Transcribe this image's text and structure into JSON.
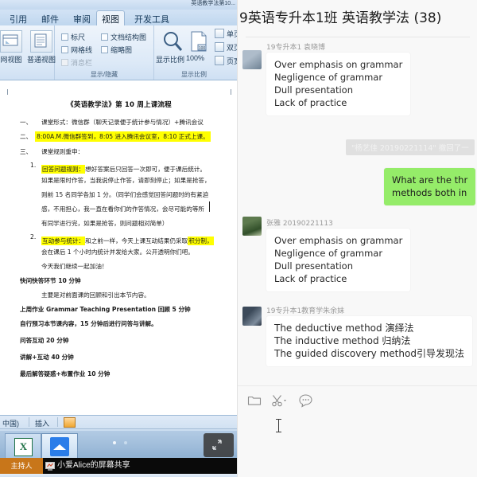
{
  "word": {
    "document_title": "英语教学法第10...",
    "ribbon_tabs": [
      {
        "label": "引用",
        "active": false
      },
      {
        "label": "邮件",
        "active": false
      },
      {
        "label": "审阅",
        "active": false
      },
      {
        "label": "视图",
        "active": true
      },
      {
        "label": "开发工具",
        "active": false
      }
    ],
    "view_buttons": [
      {
        "label": "网视图"
      },
      {
        "label": "普通视图"
      }
    ],
    "show_hide": {
      "group_label": "显示/隐藏",
      "checkboxes": [
        {
          "label": "标尺",
          "checked": false,
          "dim": false
        },
        {
          "label": "文档结构图",
          "checked": false,
          "dim": false
        },
        {
          "label": "网格线",
          "checked": false,
          "dim": false
        },
        {
          "label": "缩略图",
          "checked": false,
          "dim": false
        },
        {
          "label": "消息栏",
          "checked": false,
          "dim": true
        }
      ]
    },
    "zoom_group": {
      "group_label": "显示比例",
      "zoom_button_label": "显示比例",
      "zoom_value": "100%",
      "page_buttons": [
        {
          "label": "单页"
        },
        {
          "label": "双页"
        },
        {
          "label": "页宽"
        }
      ]
    },
    "document": {
      "title": "《英语教学法》第 10 周上课流程",
      "lines": [
        {
          "num": "一、",
          "text": "课堂形式：微信群（聊天记录便于统计参与情况）+腾讯会议",
          "highlight": "none"
        },
        {
          "num": "二、",
          "text": "8:00A.M.微信群签到，8:05 进入腾讯会议室，8:10 正式上课。",
          "highlight": "full"
        },
        {
          "num": "三、",
          "text": "课堂规则重申：",
          "highlight": "none"
        },
        {
          "num": "1.",
          "text": "回答问题规则：想好答案后只回答一次即可，便于课后统计。",
          "highlight": "partial",
          "hl_text": "回答问题规则："
        },
        {
          "num": "",
          "text": "如果是限时作答，当我说停止作答，请即刻停止；如果是抢答，",
          "highlight": "none"
        },
        {
          "num": "",
          "text": "则前 15 名同学各加 1 分。（同学们会感觉回答问题时的有紧迫",
          "highlight": "none"
        },
        {
          "num": "",
          "text": "感，不用担心，我一直在看你们的作答情况，会尽可能的等所",
          "highlight": "none"
        },
        {
          "num": "",
          "text": "有同学进行完，如果是抢答，则问题相对简单）",
          "highlight": "none"
        },
        {
          "num": "2.",
          "text": "互动参与统计：和之前一样，今天上课互动结果仍采取积分制，",
          "highlight": "partial2",
          "hl_text": "互动参与统计：",
          "hl_text2": "积分制，"
        },
        {
          "num": "",
          "text": "会在课后 1 个小时内统计并发给大家。公开透明你们吧。",
          "highlight": "none"
        },
        {
          "num": "",
          "text": "今天我们继续一起加油！",
          "highlight": "none"
        },
        {
          "num": "四、",
          "text": "快问快答环节   10 分钟",
          "highlight": "none"
        },
        {
          "num": "",
          "text": "主要是对前面课的回顾和引出本节内容。",
          "highlight": "none"
        },
        {
          "num": "五、",
          "text": "上周作业 Grammar Teaching Presentation 回顾   5 分钟",
          "highlight": "none"
        },
        {
          "num": "六、",
          "text": "自行预习本节课内容，15 分钟后进行问答与讲解。",
          "highlight": "none"
        },
        {
          "num": "七、",
          "text": "问答互动     20 分钟",
          "highlight": "none"
        },
        {
          "num": "八、",
          "text": "讲解+互动    40 分钟",
          "highlight": "none"
        },
        {
          "num": "九、",
          "text": "最后解答疑惑+布置作业    10 分钟",
          "highlight": "none"
        }
      ]
    },
    "status_bar": {
      "language": "中国)",
      "insert": "插入",
      "icon": "document-icon"
    }
  },
  "taskbar": {
    "items": [
      {
        "name": "excel-app",
        "label": "X"
      },
      {
        "name": "meeting-app",
        "label": ""
      }
    ],
    "restore_label": "restore-icon",
    "share_bar": {
      "host_label": "主持人",
      "share_text": "小爱Alice的屏幕共享",
      "share_icon": "screen-share-icon"
    }
  },
  "chat": {
    "title": "9英语专升本1班 英语教学法 (38)",
    "messages": [
      {
        "type": "incoming",
        "sender": "19专升本1 袁晓博",
        "avatar": "avatar-yuanxiaobo",
        "lines": [
          "Over emphasis on grammar",
          "Negligence of grammar",
          "Dull presentation",
          "Lack of practice"
        ]
      },
      {
        "type": "system",
        "text": "\"杨艺佳 20190221114\" 撤回了一"
      },
      {
        "type": "outgoing",
        "sender": "",
        "lines": [
          "What are the thr",
          "methods both in"
        ]
      },
      {
        "type": "incoming",
        "sender": "张雅  20190221113",
        "avatar": "avatar-zhangya",
        "lines": [
          "Over emphasis on grammar",
          "Negligence of grammar",
          "Dull presentation",
          "Lack of practice"
        ]
      },
      {
        "type": "incoming",
        "sender": "19专升本1教育学朱余妹",
        "avatar": "avatar-zhuyumei",
        "lines": [
          "The deductive method 演绎法",
          "The inductive method 归纳法",
          "The guided discovery method引导发现法"
        ]
      }
    ],
    "toolbar_icons": [
      {
        "name": "folder-icon",
        "label": "folder"
      },
      {
        "name": "scissors-icon",
        "label": "screenshot"
      },
      {
        "name": "emoji-icon",
        "label": "emoji"
      }
    ],
    "input_placeholder": ""
  },
  "colors": {
    "chat_green": "#95ec69",
    "chat_bg": "#f8f8f8",
    "highlight_yellow": "#ffff00",
    "ribbon_blue": "#bfd6ee",
    "host_orange": "#c8761a"
  }
}
